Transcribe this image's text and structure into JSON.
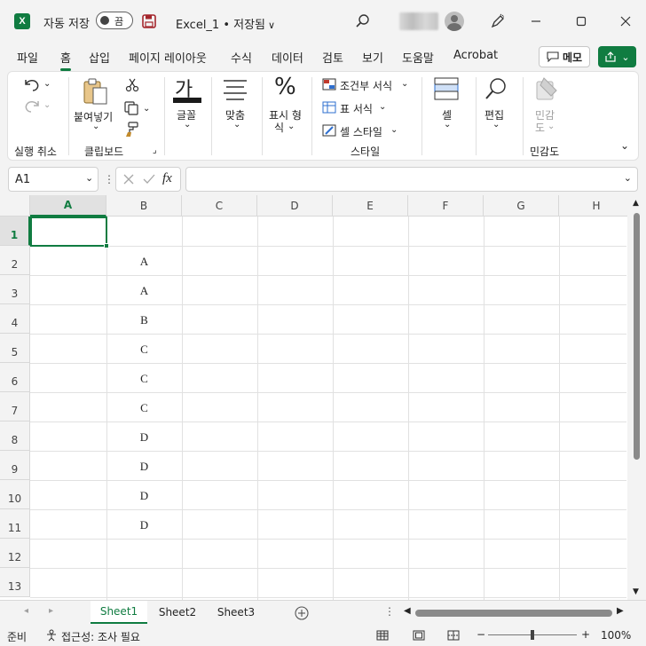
{
  "titlebar": {
    "app_icon": "X",
    "autosave_label": "자동 저장",
    "autosave_state": "끔",
    "doc_title": "Excel_1 • 저장됨",
    "chevron": "∨",
    "icons": [
      "excel-logo-icon",
      "save-icon",
      "search-icon",
      "avatar-icon",
      "pen-icon",
      "minimize-icon",
      "maximize-icon",
      "close-icon"
    ]
  },
  "tabs": [
    "파일",
    "홈",
    "삽입",
    "페이지 레이아웃",
    "수식",
    "데이터",
    "검토",
    "보기",
    "도움말",
    "Acrobat"
  ],
  "active_tab": "홈",
  "memo_label": "메모",
  "ribbon": {
    "undo_group": "실행 취소",
    "paste": "붙여넣기",
    "clipboard_group": "클립보드",
    "font_glyph": "가",
    "font": "글꼴",
    "align": "맞춤",
    "number_line1": "표시 형",
    "number_line2": "식",
    "cond_format": "조건부 서식",
    "table_format": "표 서식",
    "cell_style": "셀 스타일",
    "style_group": "스타일",
    "cells": "셀",
    "edit": "편집",
    "sensitivity_line1": "민감",
    "sensitivity_line2": "도",
    "sensitivity_group": "민감도"
  },
  "formula_bar": {
    "name_box": "A1",
    "fx": "fx",
    "formula": ""
  },
  "columns": [
    "A",
    "B",
    "C",
    "D",
    "E",
    "F",
    "G",
    "H"
  ],
  "rows": [
    "1",
    "2",
    "3",
    "4",
    "5",
    "6",
    "7",
    "8",
    "9",
    "10",
    "11",
    "12",
    "13"
  ],
  "column_b": [
    "",
    "A",
    "A",
    "B",
    "C",
    "C",
    "C",
    "D",
    "D",
    "D",
    "D",
    "",
    ""
  ],
  "sheets": [
    "Sheet1",
    "Sheet2",
    "Sheet3"
  ],
  "active_sheet": "Sheet1",
  "status": {
    "ready": "준비",
    "accessibility": "접근성: 조사 필요",
    "zoom": "100%",
    "minus": "−",
    "plus": "+"
  },
  "colors": {
    "accent": "#107c41"
  }
}
